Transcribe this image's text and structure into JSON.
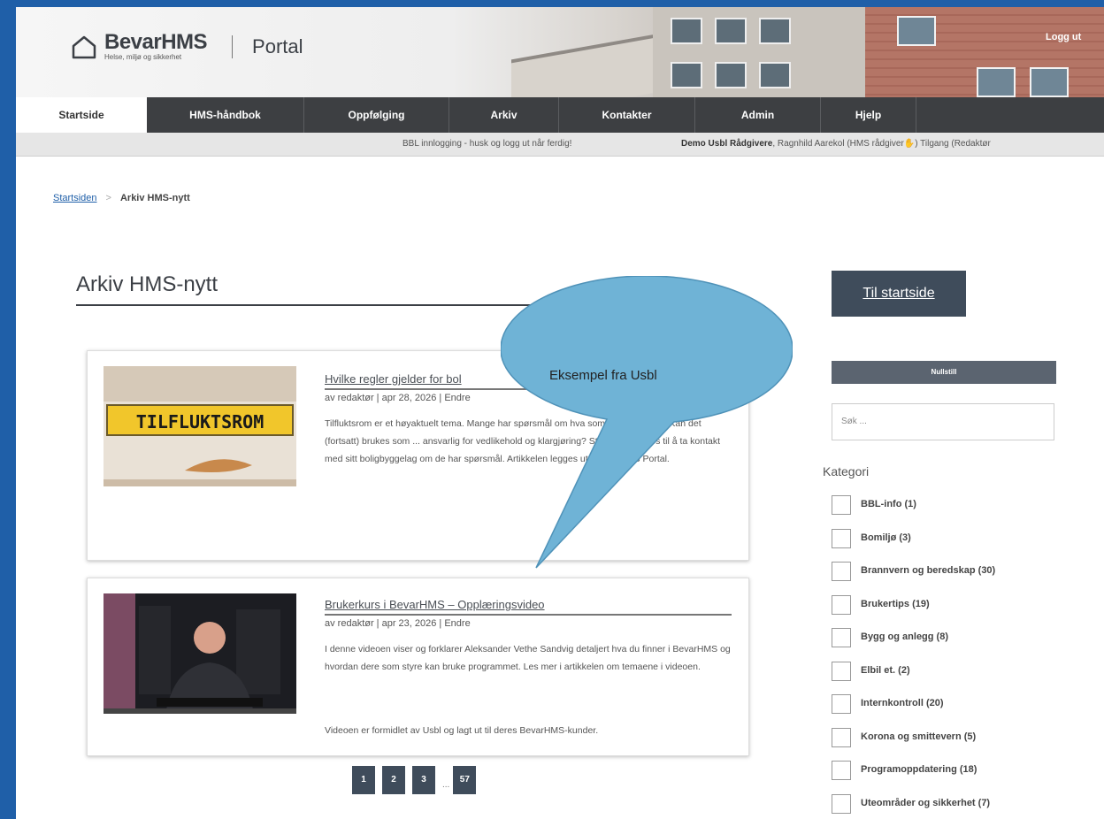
{
  "header": {
    "brand": "BevarHMS",
    "tagline": "Helse, miljø og sikkerhet",
    "portal": "Portal",
    "logout": "Logg ut"
  },
  "nav": [
    {
      "label": "Startside",
      "active": true
    },
    {
      "label": "HMS-håndbok"
    },
    {
      "label": "Oppfølging"
    },
    {
      "label": "Arkiv"
    },
    {
      "label": "Kontakter"
    },
    {
      "label": "Admin"
    },
    {
      "label": "Hjelp"
    }
  ],
  "infobar": {
    "message": "BBL innlogging - husk og logg ut når ferdig!",
    "org": "Demo Usbl Rådgivere",
    "user": ", Ragnhild Aarekol (HMS rådgiver",
    "access": ") Tilgang (Redaktør"
  },
  "breadcrumb": {
    "home": "Startsiden",
    "separator": ">",
    "current": "Arkiv HMS-nytt"
  },
  "page_title": "Arkiv HMS-nytt",
  "articles": [
    {
      "title": "Hvilke regler gjelder for bol",
      "meta": "av redaktør | apr 28, 2026 | Endre",
      "image_text": "TILFLUKTSROM",
      "body": "Tilfluktsrom er et høyaktuelt tema. Mange har spørsmål om hva som ... det fjernes? Kan det (fortsatt) brukes som ... ansvarlig for vedlikehold og klargjøring? Styret oppfordres til å ta kontakt med sitt boligbyggelag om de har spørsmål. Artikkelen legges ut i BevarHMS Portal."
    },
    {
      "title": "Brukerkurs i BevarHMS – Opplæringsvideo",
      "meta": "av redaktør | apr 23, 2026 | Endre",
      "body": "I denne videoen viser og forklarer Aleksander Vethe Sandvig detaljert hva du finner i BevarHMS og hvordan dere som styre kan bruke programmet. Les mer i artikkelen om temaene i videoen.",
      "body2": "Videoen er formidlet av Usbl og lagt ut til deres BevarHMS-kunder."
    }
  ],
  "pager": {
    "pages": [
      "1",
      "2",
      "3",
      "57"
    ],
    "ellipsis": "..."
  },
  "sidebar": {
    "to_start": "Til startside",
    "reset": "Nullstill",
    "search_placeholder": "Søk ...",
    "category_title": "Kategori",
    "categories": [
      "BBL-info (1)",
      "Bomiljø (3)",
      "Brannvern og beredskap (30)",
      "Brukertips (19)",
      "Bygg og anlegg (8)",
      "Elbil et. (2)",
      "Internkontroll (20)",
      "Korona og smittevern (5)",
      "Programoppdatering (18)",
      "Uteområder og sikkerhet (7)"
    ]
  },
  "callout": {
    "text": "Eksempel fra Usbl",
    "color": "#6fb3d6"
  },
  "colors": {
    "frame": "#1f5fa8",
    "nav": "#3d3f42",
    "button": "#3f4c5b"
  }
}
